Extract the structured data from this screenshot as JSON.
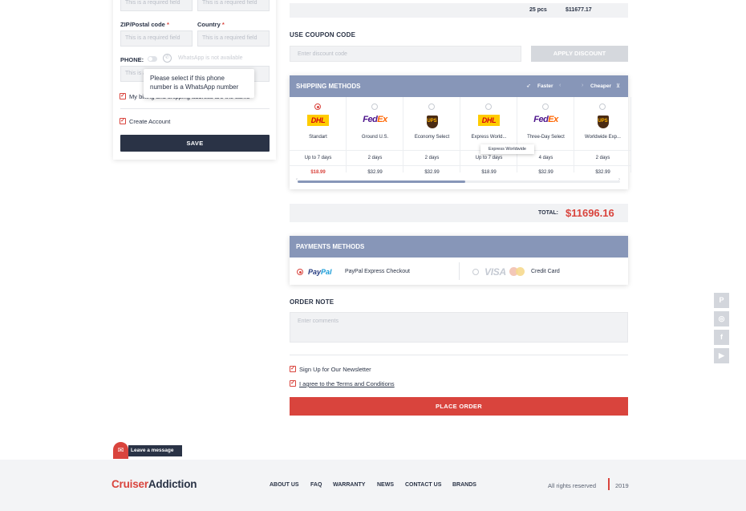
{
  "billing_form": {
    "top_fields": [
      "This is a required field",
      "This is a required field"
    ],
    "zip_label": "ZIP/Postal code",
    "country_label": "Country",
    "required_mark": "*",
    "zip_placeholder": "This is a required field",
    "country_placeholder": "This is a required field",
    "phone_label": "PHONE:",
    "whatsapp_note": "WhatsApp is not available",
    "phone_placeholder": "This is a required field",
    "tooltip": "Please select if this phone number is a WhatsApp number",
    "same_address_label": "My billing and shipping address are the same",
    "create_account_label": "Create Account",
    "save_label": "SAVE"
  },
  "summary": {
    "qty": "25 pcs",
    "amount": "$11677.17"
  },
  "coupon": {
    "title": "USE COUPON CODE",
    "placeholder": "Enter discount code",
    "button": "APPLY DISCOUNT"
  },
  "shipping": {
    "title": "SHIPPING METHODS",
    "faster": "Faster",
    "cheaper": "Cheaper",
    "carriers": [
      {
        "logo": "DHL",
        "name": "Standart",
        "days": "Up to 7 days",
        "price": "$18.99",
        "selected": true
      },
      {
        "logo": "FedEx",
        "name": "Ground U.S.",
        "days": "2 days",
        "price": "$32.99",
        "selected": false
      },
      {
        "logo": "UPS",
        "name": "Economy Select",
        "days": "2 days",
        "price": "$32.99",
        "selected": false
      },
      {
        "logo": "DHL",
        "name": "Express World...",
        "days": "Up to 7 days",
        "price": "$18.99",
        "selected": false
      },
      {
        "logo": "FedEx",
        "name": "Three-Day Select",
        "days": "4 days",
        "price": "$32.99",
        "selected": false
      },
      {
        "logo": "UPS",
        "name": "Worldwide Exp...",
        "days": "2 days",
        "price": "$32.99",
        "selected": false
      }
    ],
    "tooltip": "Express Worldwide",
    "scroll_position": 0.52
  },
  "total": {
    "label": "TOTAL:",
    "value": "$11696.16"
  },
  "payments": {
    "title": "PAYMENTS METHODS",
    "paypal_brand_1": "Pay",
    "paypal_brand_2": "Pal",
    "paypal_label": "PayPal Express Checkout",
    "visa_brand": "VISA",
    "card_label": "Credit Card"
  },
  "order_note": {
    "title": "ORDER NOTE",
    "placeholder": "Enter comments"
  },
  "agreements": {
    "newsletter": "Sign Up for Our Newsletter",
    "terms": "I agree to the Terms and Conditions"
  },
  "place_order": "PLACE ORDER",
  "leave_message": "Leave a message",
  "social": [
    "pinterest-icon",
    "instagram-icon",
    "facebook-icon",
    "youtube-icon"
  ],
  "footer": {
    "brand_1": "Cruiser",
    "brand_2": "Addiction",
    "nav": [
      "ABOUT US",
      "FAQ",
      "WARRANTY",
      "NEWS",
      "CONTACT US",
      "BRANDS"
    ],
    "rights": "All rights reserved",
    "year": "2019"
  },
  "colors": {
    "accent": "#d9443d",
    "dark": "#2a3346",
    "section_header": "#8796b8"
  }
}
